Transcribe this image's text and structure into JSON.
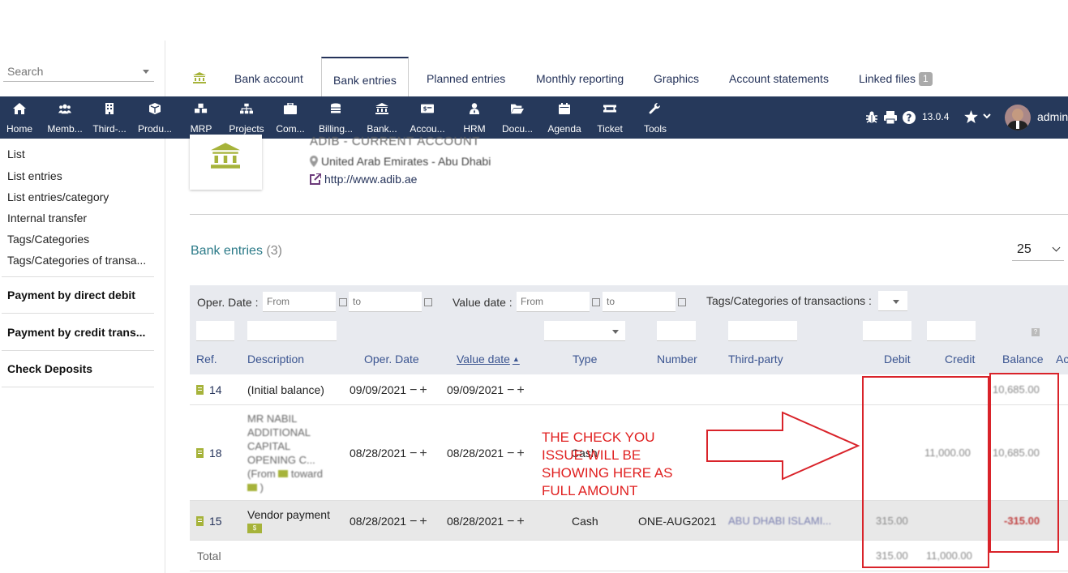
{
  "sidebar": {
    "search_placeholder": "Search",
    "items": [
      "List",
      "List entries",
      "List entries/category",
      "Internal transfer",
      "Tags/Categories",
      "Tags/Categories of transa..."
    ],
    "sections": [
      "Payment by direct debit",
      "Payment by credit trans...",
      "Check Deposits"
    ]
  },
  "tabs": [
    {
      "label": "Bank account"
    },
    {
      "label": "Bank entries"
    },
    {
      "label": "Planned entries"
    },
    {
      "label": "Monthly reporting"
    },
    {
      "label": "Graphics"
    },
    {
      "label": "Account statements"
    },
    {
      "label": "Linked files",
      "badge": "1"
    }
  ],
  "topnav": [
    {
      "label": "Home",
      "icon": "home-icon"
    },
    {
      "label": "Memb...",
      "icon": "members-icon"
    },
    {
      "label": "Third-...",
      "icon": "building-icon"
    },
    {
      "label": "Produ...",
      "icon": "cube-icon"
    },
    {
      "label": "MRP",
      "icon": "cubes-icon"
    },
    {
      "label": "Projects",
      "icon": "sitemap-icon"
    },
    {
      "label": "Com...",
      "icon": "briefcase-icon"
    },
    {
      "label": "Billing...",
      "icon": "coins-icon"
    },
    {
      "label": "Bank...",
      "icon": "bank-icon"
    },
    {
      "label": "Accou...",
      "icon": "accounting-icon"
    },
    {
      "label": "HRM",
      "icon": "user-tie-icon"
    },
    {
      "label": "Docu...",
      "icon": "folder-open-icon"
    },
    {
      "label": "Agenda",
      "icon": "calendar-icon"
    },
    {
      "label": "Ticket",
      "icon": "ticket-icon"
    },
    {
      "label": "Tools",
      "icon": "wrench-icon"
    }
  ],
  "topright": {
    "version": "13.0.4",
    "user": "admin"
  },
  "bank": {
    "name": "ADIB - CURRENT ACCOUNT",
    "location": "United Arab Emirates - Abu Dhabi",
    "url": "http://www.adib.ae"
  },
  "entries": {
    "title": "Bank entries",
    "count": "(3)",
    "per_page": "25"
  },
  "filters": {
    "oper_date_label": "Oper. Date :",
    "value_date_label": "Value date :",
    "tags_label": "Tags/Categories of transactions :",
    "from_placeholder": "From",
    "to_placeholder": "to"
  },
  "columns": {
    "ref": "Ref.",
    "description": "Description",
    "oper_date": "Oper. Date",
    "value_date": "Value date",
    "type": "Type",
    "number": "Number",
    "third_party": "Third-party",
    "debit": "Debit",
    "credit": "Credit",
    "balance": "Balance",
    "actions": "Ac"
  },
  "rows": [
    {
      "ref": "14",
      "description": "(Initial balance)",
      "oper_date": "09/09/2021",
      "value_date": "09/09/2021",
      "type": "",
      "number": "",
      "third_party": "",
      "debit": "",
      "credit": "",
      "balance": "10,685.00"
    },
    {
      "ref": "18",
      "desc_lines": [
        "MR NABIL",
        "ADDITIONAL",
        "CAPITAL",
        "OPENING C...",
        "(From",
        "toward",
        ")"
      ],
      "oper_date": "08/28/2021",
      "value_date": "08/28/2021",
      "type": "Cash",
      "number": "",
      "third_party": "",
      "debit": "",
      "credit": "11,000.00",
      "balance": "10,685.00"
    },
    {
      "ref": "15",
      "description": "Vendor payment",
      "oper_date": "08/28/2021",
      "value_date": "08/28/2021",
      "type": "Cash",
      "number": "ONE-AUG2021",
      "third_party": "ABU DHABI ISLAMI...",
      "debit": "315.00",
      "credit": "",
      "balance": "-315.00"
    }
  ],
  "total": {
    "label": "Total",
    "debit": "315.00",
    "credit": "11,000.00"
  },
  "annotation": {
    "text": "THE CHECK YOU ISSUE WILL BE SHOWING HERE AS FULL AMOUNT",
    "color": "#e02020"
  },
  "colors": {
    "navbar": "#26395b",
    "accent": "#2b7a88",
    "filter_bg": "#e8eaef",
    "annotation_red": "#d9232a"
  }
}
